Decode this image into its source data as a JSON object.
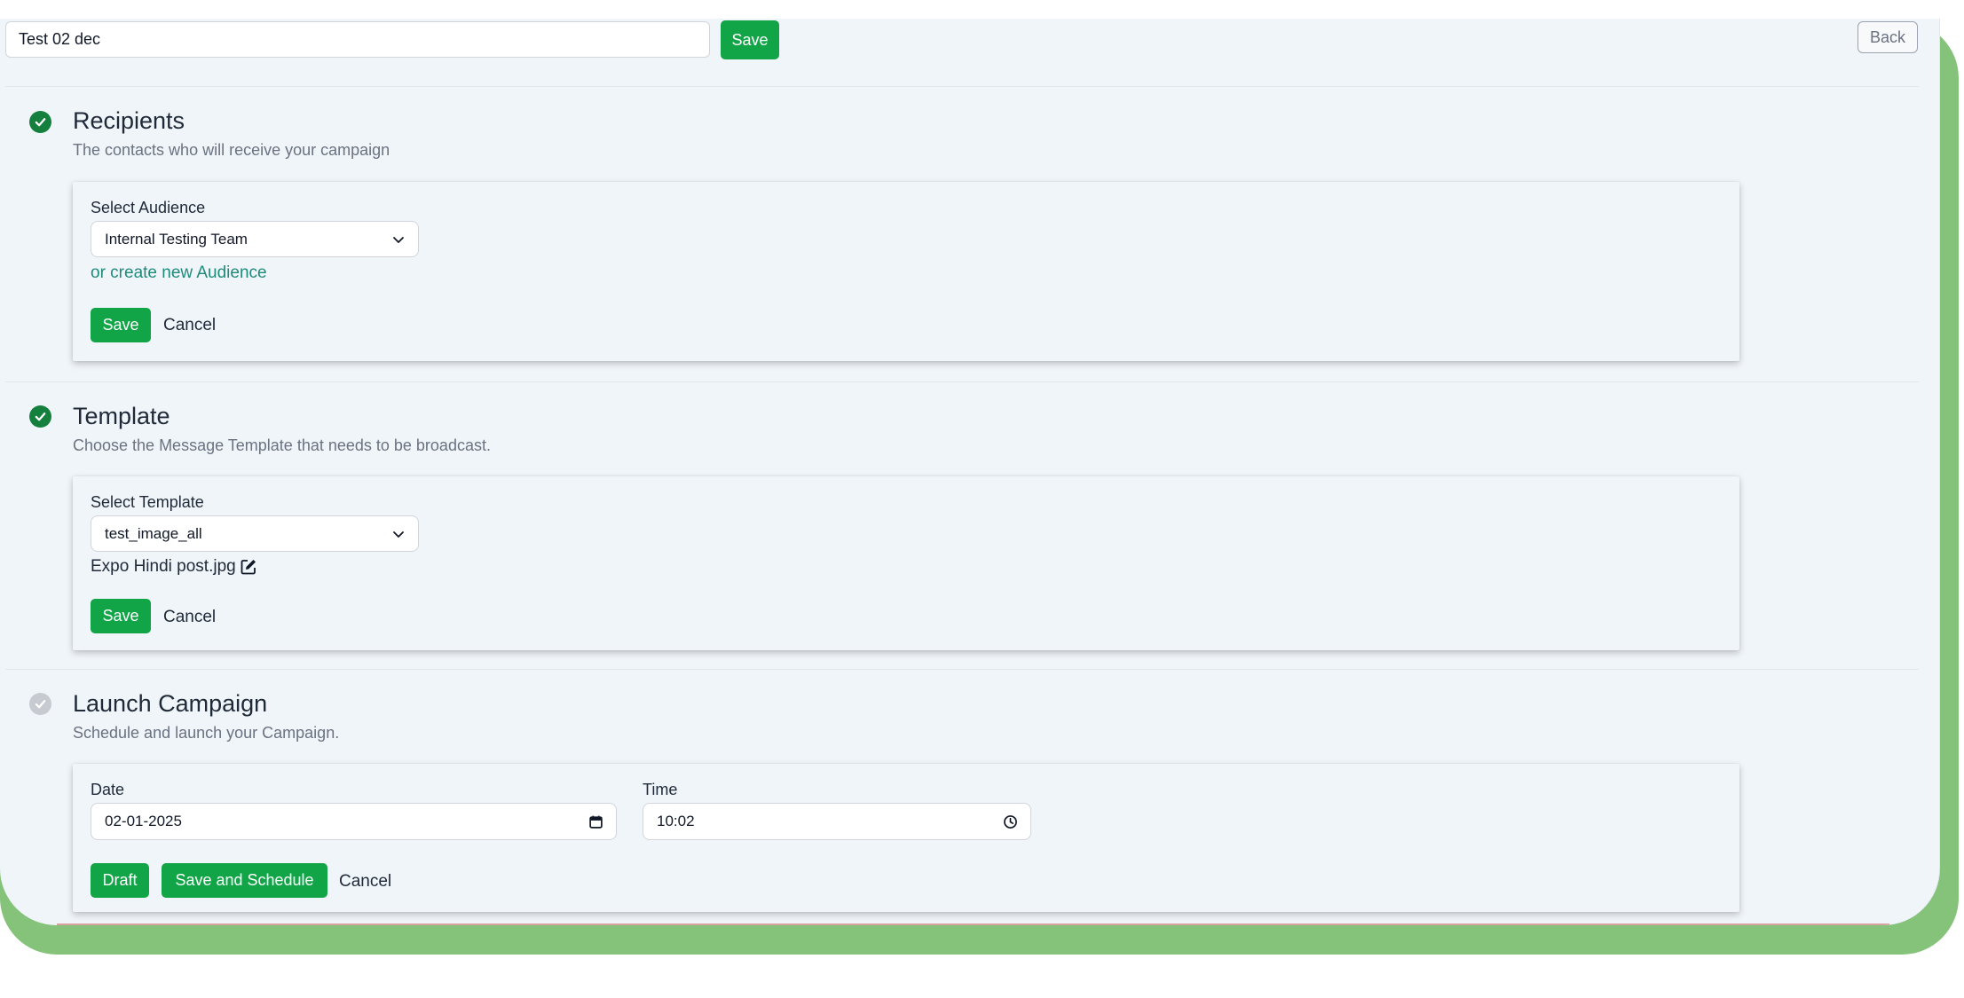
{
  "header": {
    "campaign_name": "Test 02 dec",
    "save_label": "Save",
    "back_label": "Back"
  },
  "sections": {
    "recipients": {
      "title": "Recipients",
      "subtitle": "The contacts who will receive your campaign",
      "status": "complete",
      "field_label": "Select Audience",
      "selected_audience": "Internal Testing Team",
      "create_link": "or create new Audience",
      "save_label": "Save",
      "cancel_label": "Cancel"
    },
    "template": {
      "title": "Template",
      "subtitle": "Choose the Message Template that needs to be broadcast.",
      "status": "complete",
      "field_label": "Select Template",
      "selected_template": "test_image_all",
      "attachment_name": "Expo Hindi post.jpg",
      "attachment_icon": "edit-icon",
      "save_label": "Save",
      "cancel_label": "Cancel"
    },
    "launch": {
      "title": "Launch Campaign",
      "subtitle": "Schedule and launch your Campaign.",
      "status": "pending",
      "date_label": "Date",
      "date_value": "02-01-2025",
      "time_label": "Time",
      "time_value": "10:02",
      "draft_label": "Draft",
      "schedule_label": "Save and Schedule",
      "cancel_label": "Cancel"
    }
  },
  "colors": {
    "primary_button": "#12a548",
    "check_complete": "#15803d",
    "check_pending": "#c7cbd1",
    "link": "#1f8a7a",
    "frame": "#86c37a",
    "background": "#f0f5fa"
  }
}
